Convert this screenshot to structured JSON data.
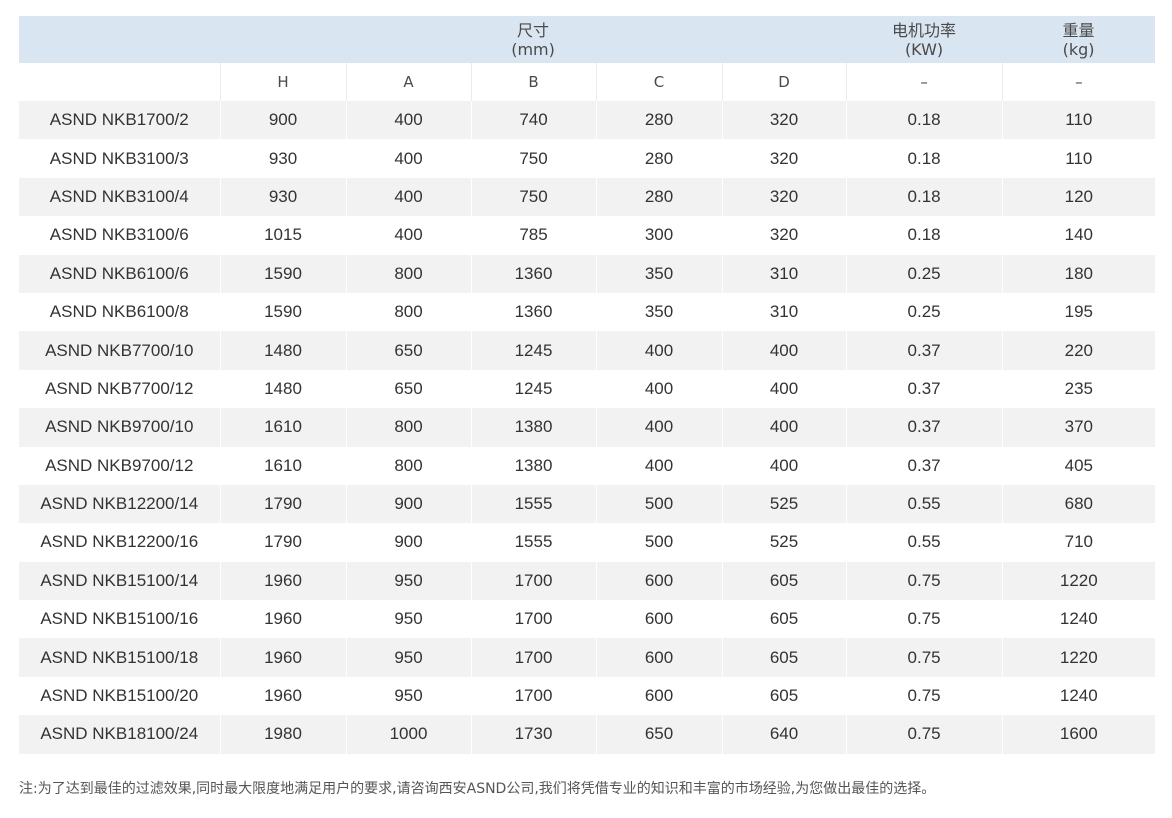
{
  "header": {
    "size_title": "尺寸",
    "size_unit": "(mm)",
    "power_title": "电机功率",
    "power_unit": "(KW)",
    "weight_title": "重量",
    "weight_unit": "(kg)"
  },
  "subheader": [
    "",
    "H",
    "A",
    "B",
    "C",
    "D",
    "–",
    "–"
  ],
  "rows": [
    [
      "ASND NKB1700/2",
      "900",
      "400",
      "740",
      "280",
      "320",
      "0.18",
      "110"
    ],
    [
      "ASND NKB3100/3",
      "930",
      "400",
      "750",
      "280",
      "320",
      "0.18",
      "110"
    ],
    [
      "ASND NKB3100/4",
      "930",
      "400",
      "750",
      "280",
      "320",
      "0.18",
      "120"
    ],
    [
      "ASND NKB3100/6",
      "1015",
      "400",
      "785",
      "300",
      "320",
      "0.18",
      "140"
    ],
    [
      "ASND NKB6100/6",
      "1590",
      "800",
      "1360",
      "350",
      "310",
      "0.25",
      "180"
    ],
    [
      "ASND NKB6100/8",
      "1590",
      "800",
      "1360",
      "350",
      "310",
      "0.25",
      "195"
    ],
    [
      "ASND NKB7700/10",
      "1480",
      "650",
      "1245",
      "400",
      "400",
      "0.37",
      "220"
    ],
    [
      "ASND NKB7700/12",
      "1480",
      "650",
      "1245",
      "400",
      "400",
      "0.37",
      "235"
    ],
    [
      "ASND NKB9700/10",
      "1610",
      "800",
      "1380",
      "400",
      "400",
      "0.37",
      "370"
    ],
    [
      "ASND NKB9700/12",
      "1610",
      "800",
      "1380",
      "400",
      "400",
      "0.37",
      "405"
    ],
    [
      "ASND NKB12200/14",
      "1790",
      "900",
      "1555",
      "500",
      "525",
      "0.55",
      "680"
    ],
    [
      "ASND NKB12200/16",
      "1790",
      "900",
      "1555",
      "500",
      "525",
      "0.55",
      "710"
    ],
    [
      "ASND NKB15100/14",
      "1960",
      "950",
      "1700",
      "600",
      "605",
      "0.75",
      "1220"
    ],
    [
      "ASND NKB15100/16",
      "1960",
      "950",
      "1700",
      "600",
      "605",
      "0.75",
      "1240"
    ],
    [
      "ASND NKB15100/18",
      "1960",
      "950",
      "1700",
      "600",
      "605",
      "0.75",
      "1220"
    ],
    [
      "ASND NKB15100/20",
      "1960",
      "950",
      "1700",
      "600",
      "605",
      "0.75",
      "1240"
    ],
    [
      "ASND NKB18100/24",
      "1980",
      "1000",
      "1730",
      "650",
      "640",
      "0.75",
      "1600"
    ]
  ],
  "note": "注:为了达到最佳的过滤效果,同时最大限度地满足用户的要求,请咨询西安ASND公司,我们将凭借专业的知识和丰富的市场经验,为您做出最佳的选择。"
}
